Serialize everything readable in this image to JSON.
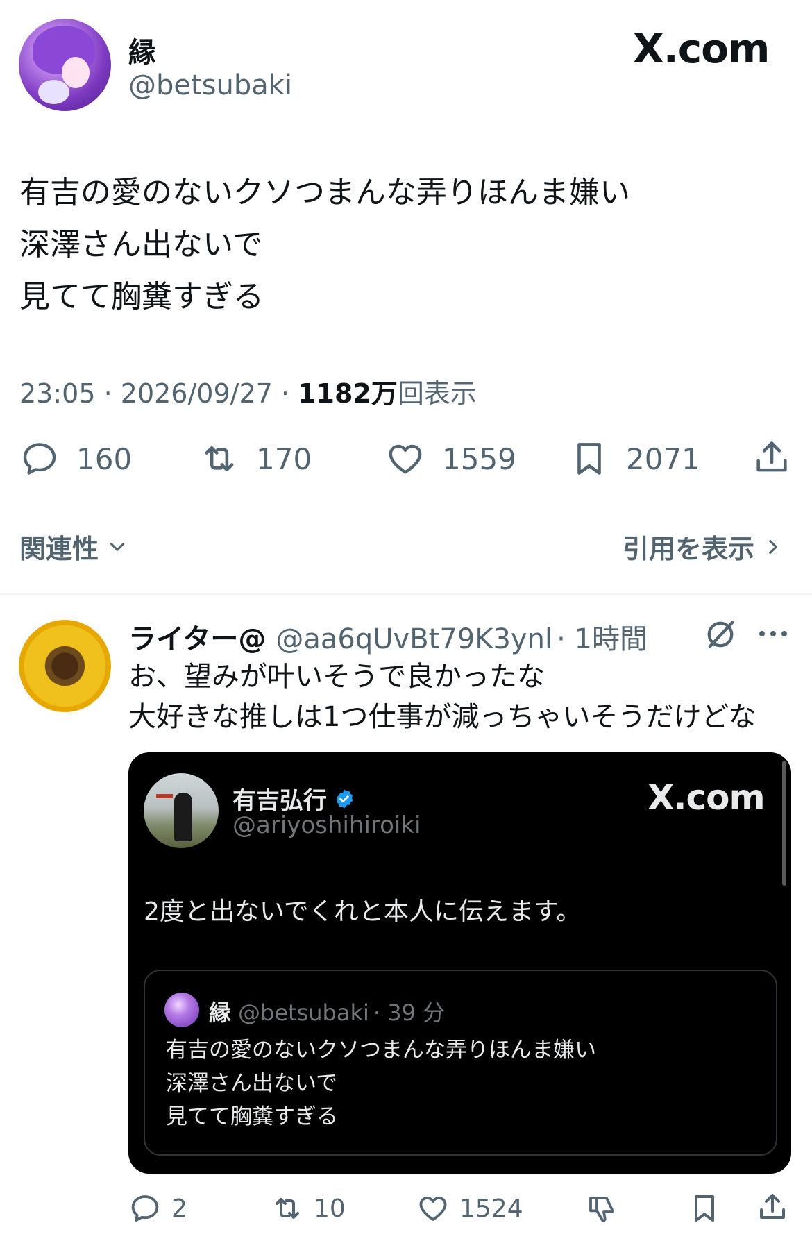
{
  "tweet": {
    "author_name": "縁",
    "author_handle": "@betsubaki",
    "brand": "X.com",
    "text_lines": [
      "有吉の愛のないクソつまんな弄りほんま嫌い",
      "深澤さん出ないで",
      "見てて胸糞すぎる"
    ],
    "time": "23:05",
    "date": "2026/09/27",
    "views": "1182万",
    "views_suffix": "回表示",
    "replies": "160",
    "reposts": "170",
    "likes": "1559",
    "bookmarks": "2071"
  },
  "sort": {
    "relevance_label": "関連性",
    "quotes_label": "引用を表示"
  },
  "reply": {
    "author_name": "ライター@",
    "author_handle": "@aa6qUvBt79K3ynl",
    "time": "· 1時間",
    "text_lines": [
      "お、望みが叶いそうで良かったな",
      "大好きな推しは1つ仕事が減っちゃいそうだけどな"
    ],
    "embed": {
      "author_name": "有吉弘行",
      "author_handle": "@ariyoshihiroiki",
      "brand": "X.com",
      "text": "2度と出ないでくれと本人に伝えます。",
      "quoted": {
        "author_name": "縁",
        "author_handle": "@betsubaki",
        "time": "· 39 分",
        "text_lines": [
          "有吉の愛のないクソつまんな弄りほんま嫌い",
          "深澤さん出ないで",
          "見てて胸糞すぎる"
        ]
      }
    },
    "replies": "2",
    "reposts": "10",
    "likes": "1524"
  },
  "colors": {
    "text_primary": "#0f1419",
    "text_secondary": "#536471",
    "verified": "#1d9bf0",
    "embed_bg": "#000000"
  }
}
